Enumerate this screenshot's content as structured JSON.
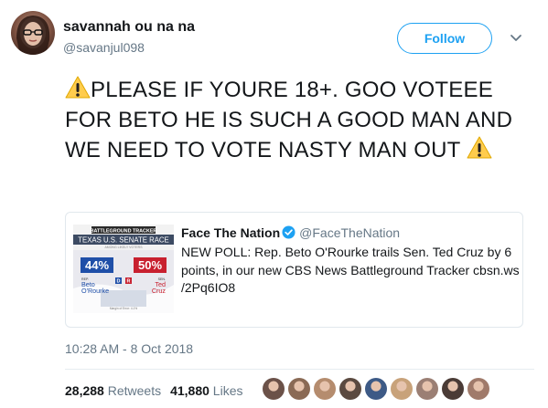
{
  "author": {
    "display_name": "savannah ou na na",
    "handle": "@savanjul098"
  },
  "follow_label": "Follow",
  "tweet": {
    "text": "PLEASE IF YOURE 18+. GOO VOTEEE FOR BETO HE IS SUCH A GOOD MAN AND WE NEED TO VOTE NASTY MAN OUT"
  },
  "quoted": {
    "name": "Face The Nation",
    "handle": "@FaceTheNation",
    "text": "NEW POLL: Rep. Beto O'Rourke trails Sen. Ted Cruz by 6 points, in our new CBS News Battleground Tracker cbsn.ws /2Pq6IO8",
    "thumb": {
      "banner": "BATTLEGROUND TRACKER",
      "title": "TEXAS U.S. SENATE RACE",
      "subtitle": "AMONG LIKELY VOTERS",
      "left_pct": "44%",
      "right_pct": "50%",
      "left_party": "D",
      "right_party": "R",
      "left_role": "REP.",
      "left_name1": "Beto",
      "left_name2": "O'Rourke",
      "right_role": "SEN.",
      "right_name1": "Ted",
      "right_name2": "Cruz",
      "footnote": "Margin of Error: 4.1%"
    }
  },
  "timestamp": "10:28 AM - 8 Oct 2018",
  "stats": {
    "retweets_count": "28,288",
    "retweets_label": "Retweets",
    "likes_count": "41,880",
    "likes_label": "Likes"
  },
  "likers": [
    "#6b5148",
    "#8a6a55",
    "#b58c6e",
    "#5b4a40",
    "#3d5a86",
    "#c8a27a",
    "#9b7f74",
    "#4a3b36",
    "#a07a6a"
  ],
  "colors": {
    "accent": "#1da1f2",
    "secondary_text": "#657786",
    "democrat_blue": "#1f4fa8",
    "republican_red": "#c8202f"
  }
}
